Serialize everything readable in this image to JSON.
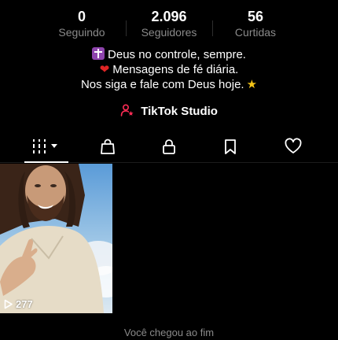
{
  "stats": [
    {
      "value": "0",
      "label": "Seguindo"
    },
    {
      "value": "2.096",
      "label": "Seguidores"
    },
    {
      "value": "56",
      "label": "Curtidas"
    }
  ],
  "bio": {
    "line1": "Deus no controle, sempre.",
    "line2": "Mensagens de fé diária.",
    "line3": "Nos siga e fale com Deus hoje.",
    "line1_icon": "latin-cross-emoji",
    "line2_icon": "red-heart-emoji",
    "line3_icon": "star-emoji"
  },
  "studio": {
    "label": "TikTok Studio",
    "icon": "person-star-icon",
    "accent": "#fe2c55"
  },
  "tabs": [
    {
      "icon": "grid-videos-icon",
      "active": true
    },
    {
      "icon": "shopping-bag-icon",
      "active": false
    },
    {
      "icon": "lock-icon",
      "active": false
    },
    {
      "icon": "bookmark-icon",
      "active": false
    },
    {
      "icon": "heart-icon",
      "active": false
    }
  ],
  "videos": [
    {
      "views": "277",
      "icon": "play-outline-icon"
    }
  ],
  "footer": {
    "end_text": "Você chegou ao fim"
  }
}
